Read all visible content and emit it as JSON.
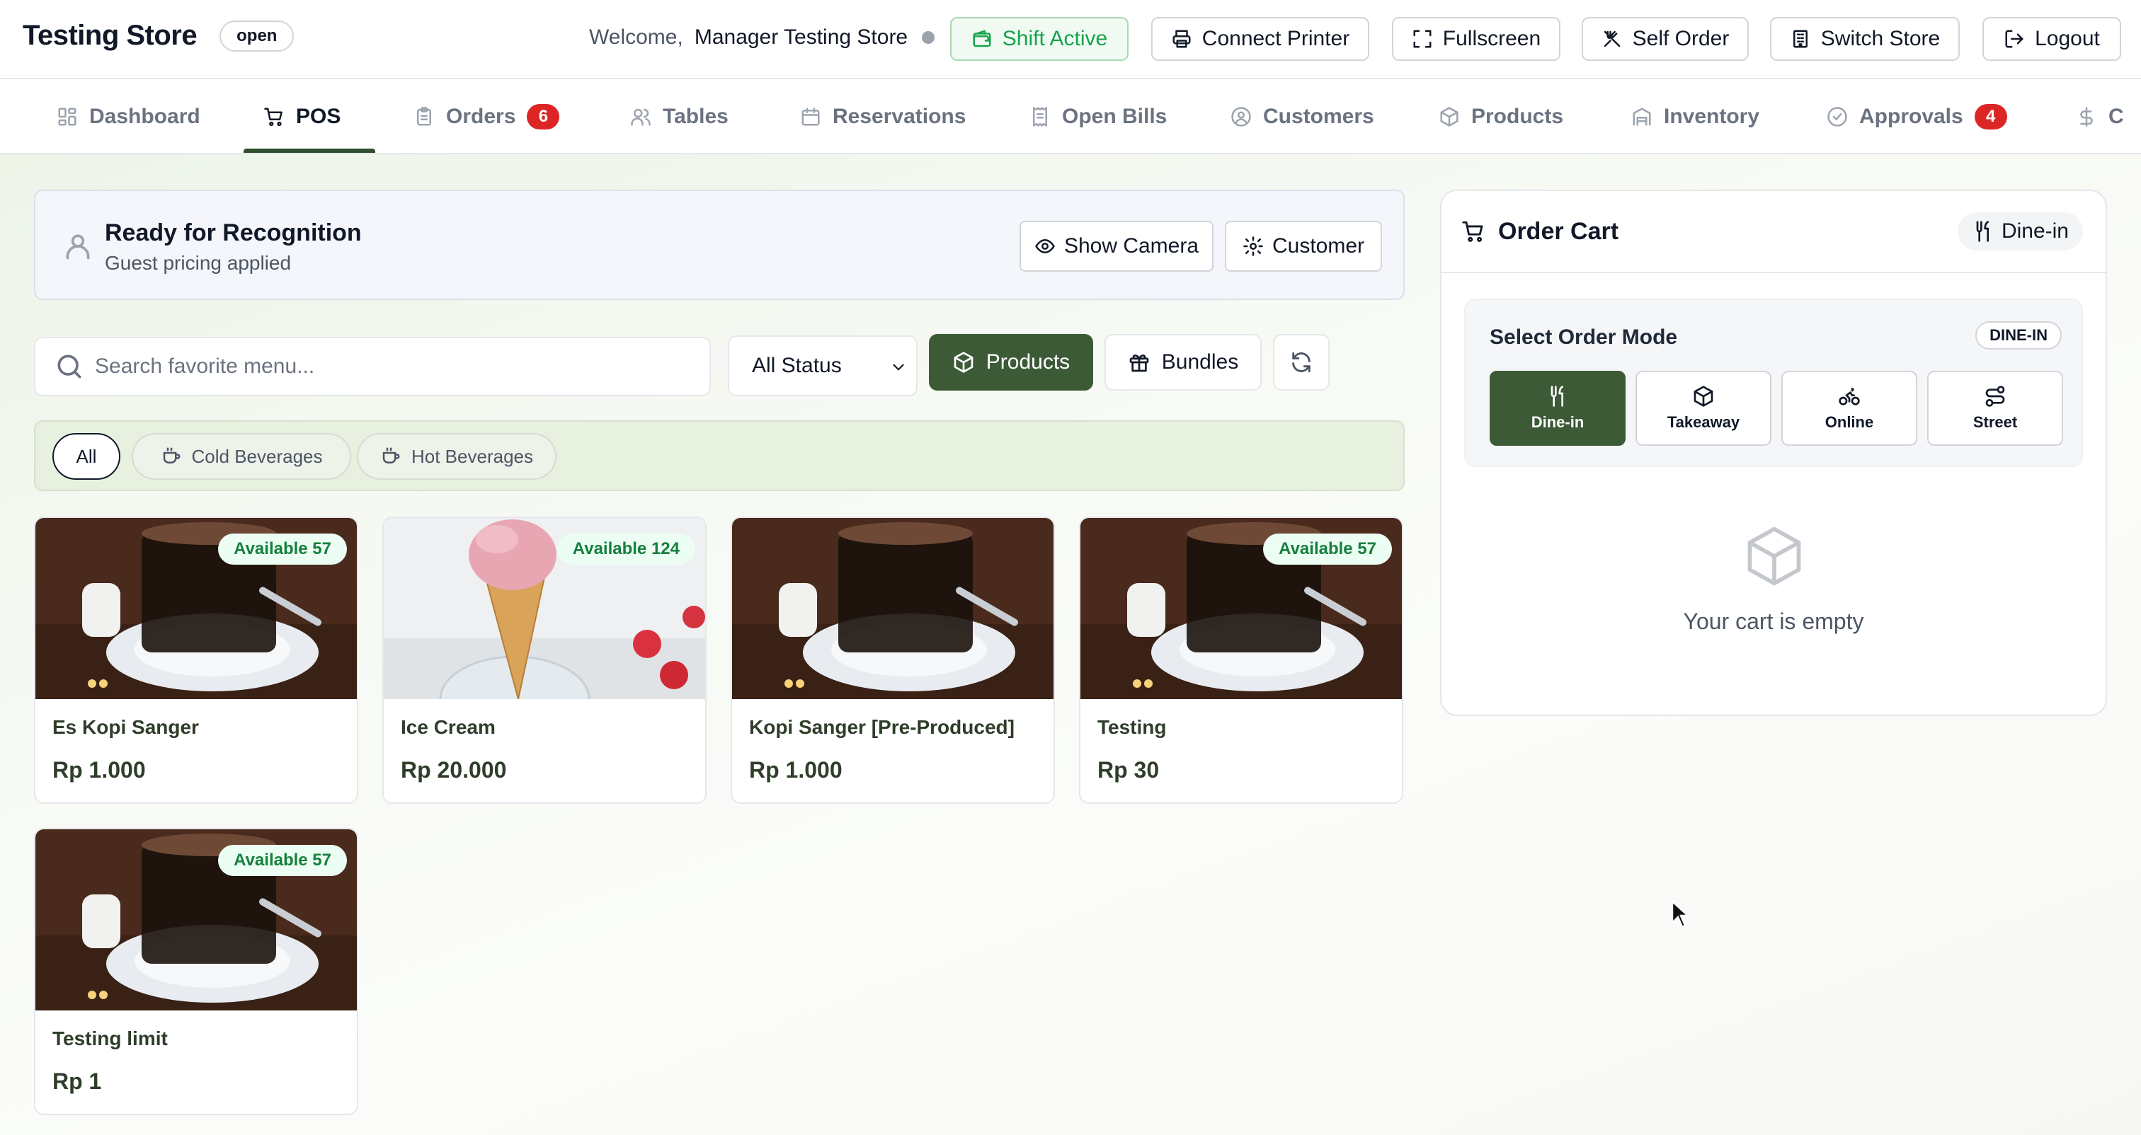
{
  "header": {
    "store_name": "Testing Store",
    "store_status": "open",
    "welcome_label": "Welcome,",
    "user_name": "Manager Testing Store",
    "buttons": {
      "shift": "Shift Active",
      "printer": "Connect Printer",
      "fullscreen": "Fullscreen",
      "self_order": "Self Order",
      "switch_store": "Switch Store",
      "logout": "Logout"
    }
  },
  "nav": {
    "active": "POS",
    "items": [
      {
        "label": "Dashboard",
        "icon": "dashboard-icon"
      },
      {
        "label": "POS",
        "icon": "cart-icon"
      },
      {
        "label": "Orders",
        "icon": "clipboard-icon",
        "badge": "6"
      },
      {
        "label": "Tables",
        "icon": "users-icon"
      },
      {
        "label": "Reservations",
        "icon": "calendar-icon"
      },
      {
        "label": "Open Bills",
        "icon": "receipt-icon"
      },
      {
        "label": "Customers",
        "icon": "user-circle-icon"
      },
      {
        "label": "Products",
        "icon": "package-icon"
      },
      {
        "label": "Inventory",
        "icon": "building-icon"
      },
      {
        "label": "Approvals",
        "icon": "check-circle-icon",
        "badge": "4"
      },
      {
        "label": "C",
        "icon": "dollar-icon"
      }
    ]
  },
  "recognition": {
    "title": "Ready for Recognition",
    "subtitle": "Guest pricing applied",
    "show_camera": "Show Camera",
    "customer": "Customer"
  },
  "filters": {
    "search_placeholder": "Search favorite menu...",
    "status_selected": "All Status",
    "products_label": "Products",
    "bundles_label": "Bundles"
  },
  "categories": [
    "All",
    "Cold Beverages",
    "Hot Beverages"
  ],
  "products": [
    {
      "name": "Es Kopi Sanger",
      "price": "Rp 1.000",
      "availability": "Available 57",
      "image": "coffee"
    },
    {
      "name": "Ice Cream",
      "price": "Rp 20.000",
      "availability": "Available 124",
      "image": "icecream"
    },
    {
      "name": "Kopi Sanger [Pre-Produced]",
      "price": "Rp 1.000",
      "availability": "",
      "image": "coffee"
    },
    {
      "name": "Testing",
      "price": "Rp 30",
      "availability": "Available 57",
      "image": "coffee"
    },
    {
      "name": "Testing limit",
      "price": "Rp 1",
      "availability": "Available 57",
      "image": "coffee"
    }
  ],
  "cart": {
    "title": "Order Cart",
    "mode_pill": "Dine-in",
    "select_mode_title": "Select Order Mode",
    "mode_tag": "DINE-IN",
    "modes": [
      "Dine-in",
      "Takeaway",
      "Online",
      "Street"
    ],
    "active_mode": "Dine-in",
    "empty_text": "Your cart is empty"
  },
  "colors": {
    "accent_dark_green": "#3d5a36",
    "shift_green": "#16a34a",
    "badge_red": "#dc2626",
    "available_green": "#15803d"
  }
}
